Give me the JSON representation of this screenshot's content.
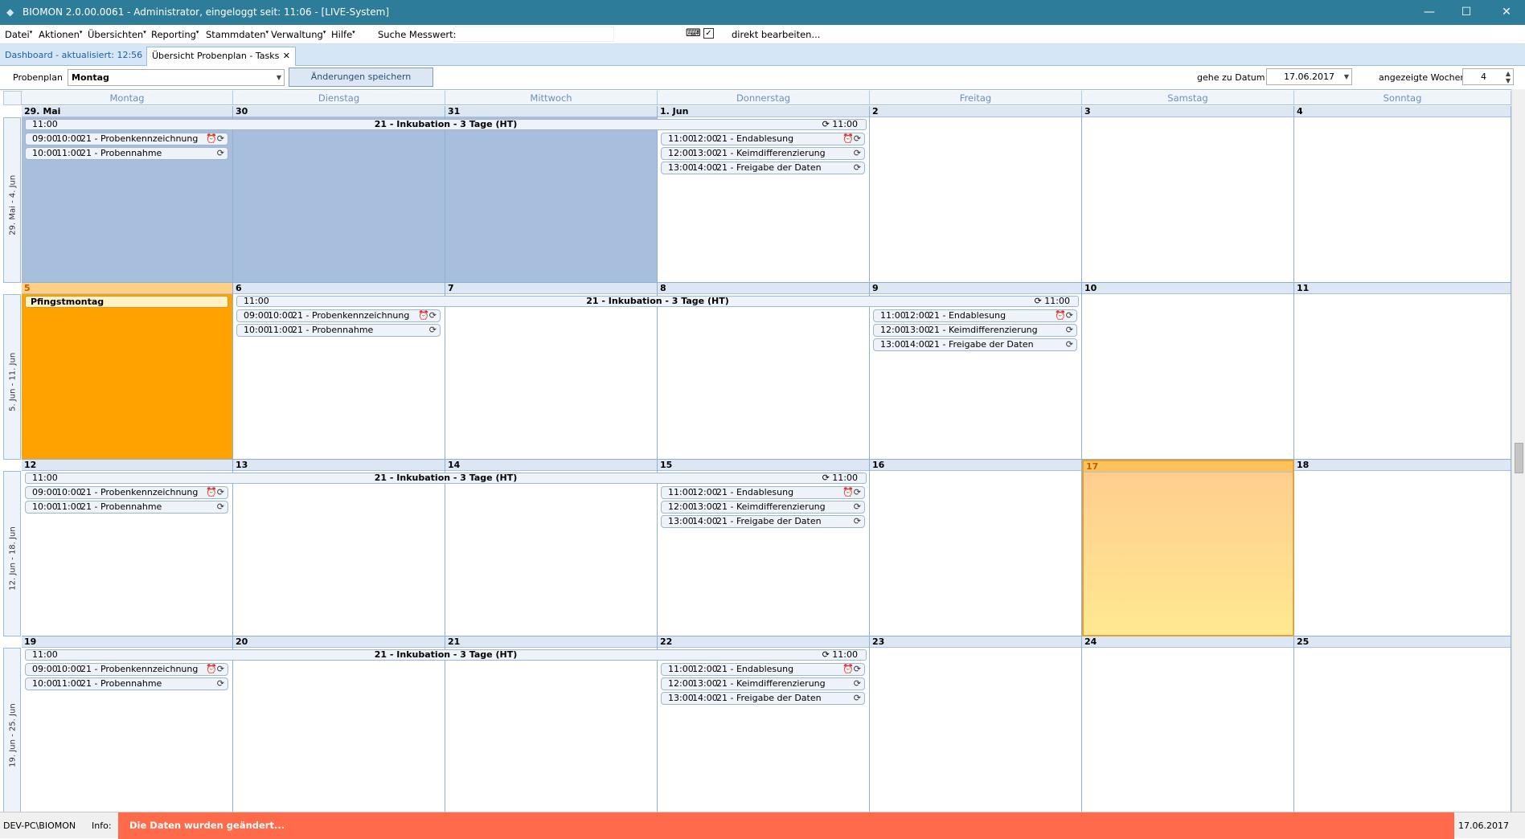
{
  "window": {
    "title": "BIOMON 2.0.00.0061 - Administrator, eingeloggt seit: 11:06 - [LIVE-System]",
    "minimize": "—",
    "maximize": "☐",
    "close": "✕"
  },
  "menu": {
    "items": [
      "Datei",
      "Aktionen",
      "Übersichten",
      "Reporting",
      "Stammdaten",
      "Verwaltung",
      "Hilfe"
    ],
    "search_label": "Suche Messwert:",
    "direct_edit": "direkt bearbeiten..."
  },
  "tabs": [
    {
      "label": "Dashboard - aktualisiert: 12:56",
      "active": false
    },
    {
      "label": "Übersicht Probenplan - Tasks",
      "active": true
    }
  ],
  "toolbar": {
    "probenplan_label": "Probenplan",
    "probenplan_value": "Montag",
    "save_button": "Änderungen speichern",
    "goto_label": "gehe zu Datum",
    "goto_value": "17.06.2017",
    "weeks_label": "angezeigte Wochen",
    "weeks_value": "4"
  },
  "calendar": {
    "weekdays": [
      "Montag",
      "Dienstag",
      "Mittwoch",
      "Donnerstag",
      "Freitag",
      "Samstag",
      "Sonntag"
    ],
    "weeks": [
      {
        "label": "29. Mai - 4. Jun",
        "days": [
          "29. Mai",
          "30",
          "31",
          "1. Jun",
          "2",
          "3",
          "4"
        ]
      },
      {
        "label": "5. Jun - 11. Jun",
        "days": [
          "5",
          "6",
          "7",
          "8",
          "9",
          "10",
          "11"
        ]
      },
      {
        "label": "12. Jun - 18. Jun",
        "days": [
          "12",
          "13",
          "14",
          "15",
          "16",
          "17",
          "18"
        ]
      },
      {
        "label": "19. Jun - 25. Jun",
        "days": [
          "19",
          "20",
          "21",
          "22",
          "23",
          "24",
          "25"
        ]
      }
    ],
    "holiday": "Pfingstmontag",
    "span_event": {
      "start": "11:00",
      "end": "11:00",
      "name": "21 - Inkubation - 3 Tage (HT)"
    },
    "start_appts": [
      {
        "from": "09:00",
        "to": "10:00",
        "name": "21 - Probenkennzeichnung"
      },
      {
        "from": "10:00",
        "to": "11:00",
        "name": "21 - Probennahme"
      }
    ],
    "end_appts": [
      {
        "from": "11:00",
        "to": "12:00",
        "name": "21 - Endablesung"
      },
      {
        "from": "12:00",
        "to": "13:00",
        "name": "21 - Keimdifferenzierung"
      },
      {
        "from": "13:00",
        "to": "14:00",
        "name": "21 - Freigabe der Daten"
      }
    ]
  },
  "status": {
    "user": "DEV-PC\\BIOMON",
    "info_label": "Info:",
    "info_message": "Die Daten wurden geändert...",
    "date": "17.06.2017"
  }
}
